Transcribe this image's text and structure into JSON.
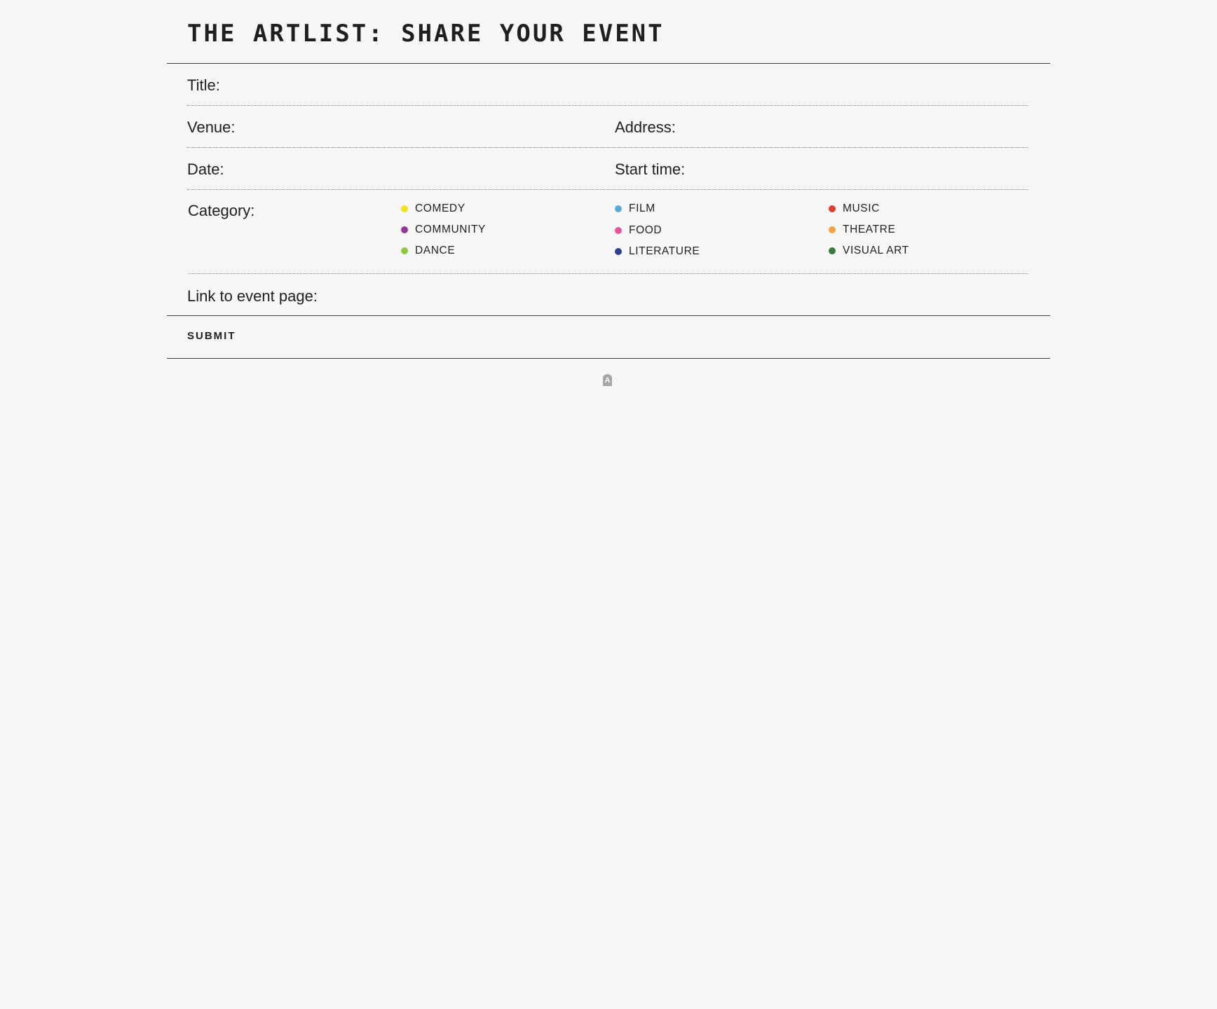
{
  "header": {
    "title": "THE ARTLIST: SHARE YOUR EVENT"
  },
  "form": {
    "title_label": "Title:",
    "venue_label": "Venue:",
    "address_label": "Address:",
    "date_label": "Date:",
    "start_time_label": "Start time:",
    "category_label": "Category:",
    "link_label": "Link to event page:",
    "categories": [
      {
        "label": "COMEDY",
        "color": "#f2e21b"
      },
      {
        "label": "COMMUNITY",
        "color": "#8e3a95"
      },
      {
        "label": "DANCE",
        "color": "#8dc63f"
      },
      {
        "label": "FILM",
        "color": "#5aa9d6"
      },
      {
        "label": "FOOD",
        "color": "#e9559b"
      },
      {
        "label": "LITERATURE",
        "color": "#2e3f8f"
      },
      {
        "label": "MUSIC",
        "color": "#e33b2e"
      },
      {
        "label": "THEATRE",
        "color": "#f4a13f"
      },
      {
        "label": "VISUAL ART",
        "color": "#3a7a3c"
      }
    ],
    "submit_label": "SUBMIT"
  },
  "footer": {
    "logo_glyph": "A",
    "logo_icon": "artlist-logo-icon"
  }
}
